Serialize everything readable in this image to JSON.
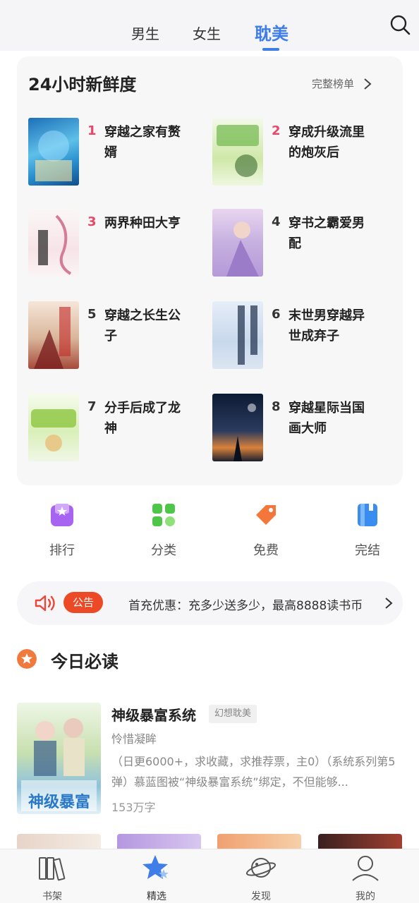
{
  "tabs": [
    {
      "label": "男生"
    },
    {
      "label": "女生"
    },
    {
      "label": "耽美"
    }
  ],
  "ranking": {
    "title": "24小时新鲜度",
    "more_label": "完整榜单",
    "items": [
      {
        "num": "1",
        "name": "穿越之家有赘婿",
        "num_color": "#e8476a"
      },
      {
        "num": "2",
        "name": "穿成升级流里的炮灰后",
        "num_color": "#e8476a"
      },
      {
        "num": "3",
        "name": "两界种田大亨",
        "num_color": "#e8476a"
      },
      {
        "num": "4",
        "name": "穿书之霸爱男配",
        "num_color": "#333333"
      },
      {
        "num": "5",
        "name": "穿越之长生公子",
        "num_color": "#333333"
      },
      {
        "num": "6",
        "name": "末世男穿越异世成弃子",
        "num_color": "#333333"
      },
      {
        "num": "7",
        "name": "分手后成了龙神",
        "num_color": "#333333"
      },
      {
        "num": "8",
        "name": "穿越星际当国画大师",
        "num_color": "#333333"
      }
    ]
  },
  "categories": [
    {
      "label": "排行",
      "icon": "rank-star-icon",
      "color": "#a764f0"
    },
    {
      "label": "分类",
      "icon": "category-grid-icon",
      "color": "#4fc64a"
    },
    {
      "label": "免费",
      "icon": "tag-icon",
      "color": "#f3763a"
    },
    {
      "label": "完结",
      "icon": "book-icon",
      "color": "#3a8df0"
    }
  ],
  "notice": {
    "badge": "公告",
    "text": "首充优惠：充多少送多少，最高8888读书币"
  },
  "today": {
    "title": "今日必读",
    "featured": {
      "title": "神级暴富系统",
      "tag": "幻想耽美",
      "author": "怜惜凝眸",
      "desc": "（日更6000+，求收藏，求推荐票，主0）（系统系列第5弹）慕蓝图被“神级暴富系统”绑定，不但能够...",
      "words": "153万字"
    }
  },
  "bottom_nav": [
    {
      "label": "书架",
      "icon": "bookshelf-icon"
    },
    {
      "label": "精选",
      "icon": "featured-star-icon"
    },
    {
      "label": "发现",
      "icon": "planet-icon"
    },
    {
      "label": "我的",
      "icon": "profile-icon"
    }
  ],
  "colors": {
    "accent": "#3f7ee8",
    "rank_top": "#e8476a",
    "notice_badge": "#ec4a26"
  }
}
